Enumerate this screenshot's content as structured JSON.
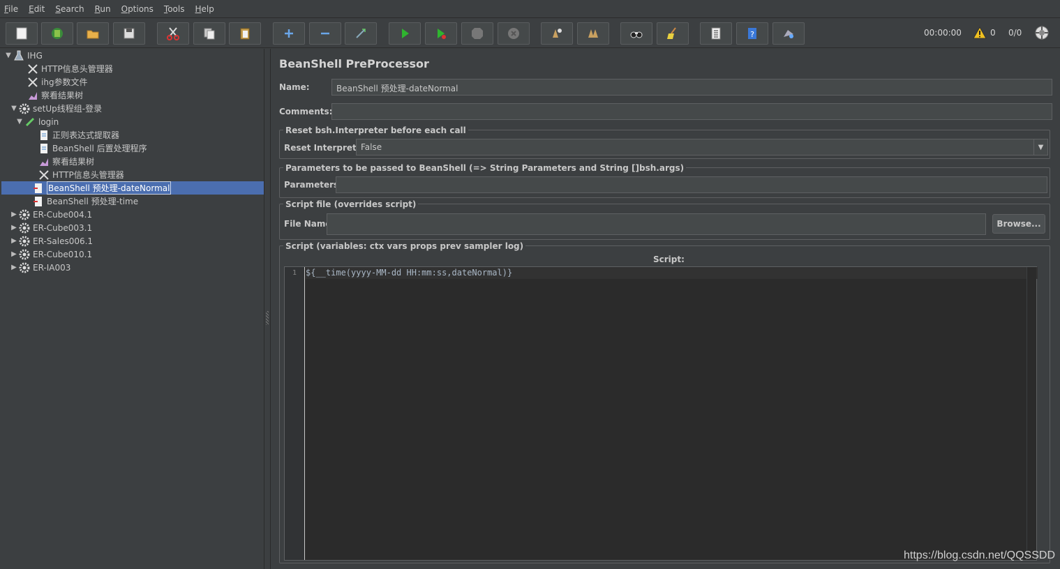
{
  "menu": [
    "File",
    "Edit",
    "Search",
    "Run",
    "Options",
    "Tools",
    "Help"
  ],
  "toolbar": {
    "buttons": [
      {
        "name": "new-button",
        "icon": "new-icon"
      },
      {
        "name": "templates-button",
        "icon": "templates-icon"
      },
      {
        "name": "open-button",
        "icon": "open-folder-icon"
      },
      {
        "name": "save-button",
        "icon": "save-icon"
      },
      {
        "name": "cut-button",
        "icon": "cut-icon"
      },
      {
        "name": "copy-button",
        "icon": "copy-icon"
      },
      {
        "name": "paste-button",
        "icon": "paste-icon"
      },
      {
        "name": "expand-button",
        "icon": "plus-icon"
      },
      {
        "name": "collapse-button",
        "icon": "minus-icon"
      },
      {
        "name": "toggle-button",
        "icon": "wand-icon"
      },
      {
        "name": "start-button",
        "icon": "play-icon"
      },
      {
        "name": "start-no-pause-button",
        "icon": "play-no-timer-icon"
      },
      {
        "name": "stop-button",
        "icon": "stop-icon"
      },
      {
        "name": "shutdown-button",
        "icon": "shutdown-icon"
      },
      {
        "name": "clear-button",
        "icon": "clear-icon"
      },
      {
        "name": "clear-all-button",
        "icon": "clear-all-icon"
      },
      {
        "name": "search-button",
        "icon": "binoculars-icon"
      },
      {
        "name": "reset-search-button",
        "icon": "broom-icon"
      },
      {
        "name": "function-helper-button",
        "icon": "list-icon"
      },
      {
        "name": "help-button",
        "icon": "help-icon"
      },
      {
        "name": "remote-button",
        "icon": "remote-icon"
      }
    ],
    "timer": "00:00:00",
    "warnings": "0",
    "threads": "0/0"
  },
  "tree": [
    {
      "label": "IHG",
      "icon": "flask-icon",
      "toggle": "▼"
    },
    {
      "label": "HTTP信息头管理器",
      "icon": "tools-icon",
      "toggle": ""
    },
    {
      "label": "ihg参数文件",
      "icon": "tools-icon",
      "toggle": ""
    },
    {
      "label": "察看结果树",
      "icon": "chart-icon",
      "toggle": ""
    },
    {
      "label": "setUp线程组-登录",
      "icon": "gear-icon",
      "toggle": "▼"
    },
    {
      "label": "login",
      "icon": "pipette-icon",
      "toggle": "▼"
    },
    {
      "label": "正则表达式提取器",
      "icon": "document-icon",
      "toggle": ""
    },
    {
      "label": "BeanShell 后置处理程序",
      "icon": "document-icon",
      "toggle": ""
    },
    {
      "label": "察看结果树",
      "icon": "chart-icon",
      "toggle": ""
    },
    {
      "label": "HTTP信息头管理器",
      "icon": "tools-icon",
      "toggle": ""
    },
    {
      "label": "BeanShell 预处理-dateNormal",
      "icon": "preprocessor-icon",
      "toggle": ""
    },
    {
      "label": "BeanShell 预处理-time",
      "icon": "preprocessor-icon",
      "toggle": ""
    },
    {
      "label": "ER-Cube004.1",
      "icon": "gear-icon",
      "toggle": "▶"
    },
    {
      "label": "ER-Cube003.1",
      "icon": "gear-icon",
      "toggle": "▶"
    },
    {
      "label": "ER-Sales006.1",
      "icon": "gear-icon",
      "toggle": "▶"
    },
    {
      "label": "ER-Cube010.1",
      "icon": "gear-icon",
      "toggle": "▶"
    },
    {
      "label": "ER-IA003",
      "icon": "gear-icon",
      "toggle": "▶"
    }
  ],
  "panel": {
    "title": "BeanShell PreProcessor",
    "name_label": "Name:",
    "name_value": "BeanShell 预处理-dateNormal",
    "comments_label": "Comments:",
    "comments_value": "",
    "reset_group": "Reset bsh.Interpreter before each call",
    "reset_label": "Reset Interpreter:",
    "reset_value": "False",
    "params_group": "Parameters to be passed to BeanShell (=> String Parameters and String []bsh.args)",
    "params_label": "Parameters:",
    "params_value": "",
    "file_group": "Script file (overrides script)",
    "file_label": "File Name:",
    "file_value": "",
    "browse_label": "Browse...",
    "script_group": "Script (variables: ctx vars props prev sampler log)",
    "script_header": "Script:",
    "line_number": "1",
    "script_code": "${__time(yyyy-MM-dd HH:mm:ss,dateNormal)}"
  },
  "watermark": "https://blog.csdn.net/QQSSDD"
}
